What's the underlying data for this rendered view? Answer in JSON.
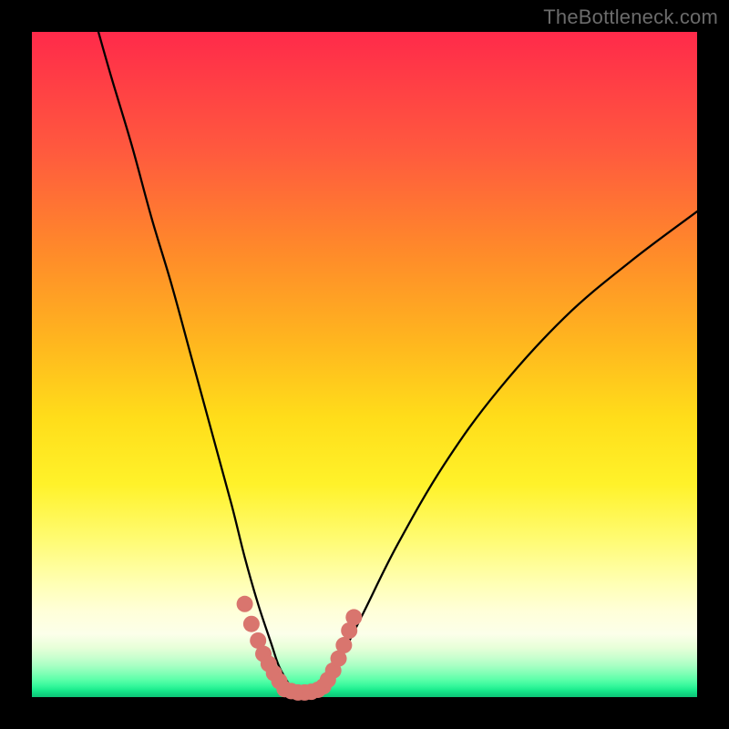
{
  "watermark": "TheBottleneck.com",
  "chart_data": {
    "type": "line",
    "title": "",
    "xlabel": "",
    "ylabel": "",
    "xlim": [
      0,
      100
    ],
    "ylim": [
      0,
      100
    ],
    "grid": false,
    "legend": false,
    "series": [
      {
        "name": "bottleneck-curve",
        "x": [
          10,
          12,
          15,
          18,
          21,
          24,
          27,
          30,
          32,
          34,
          36,
          37,
          38,
          39,
          40,
          41,
          42,
          43,
          44,
          45,
          47,
          50,
          55,
          62,
          70,
          80,
          90,
          100
        ],
        "y": [
          100,
          93,
          83,
          72,
          62,
          51,
          40,
          29,
          21,
          14,
          8,
          5,
          3,
          1.5,
          0.8,
          0.5,
          0.5,
          0.8,
          1.5,
          3,
          7,
          13,
          23,
          35,
          46,
          57,
          65.5,
          73
        ]
      }
    ],
    "optimal_range_x": [
      36,
      45
    ],
    "annotations": [
      {
        "name": "left-marker-cluster",
        "approx_x_range": [
          32,
          38
        ],
        "approx_y_range": [
          3,
          14
        ]
      },
      {
        "name": "right-marker-cluster",
        "approx_x_range": [
          44,
          48
        ],
        "approx_y_range": [
          3,
          12
        ]
      },
      {
        "name": "valley-marker-band",
        "approx_x_range": [
          38,
          44
        ],
        "approx_y_range": [
          0.5,
          2
        ]
      }
    ],
    "gradient_stops": [
      {
        "pct": 0,
        "color": "#ff2a4a"
      },
      {
        "pct": 33,
        "color": "#ff8a2a"
      },
      {
        "pct": 58,
        "color": "#ffdd1a"
      },
      {
        "pct": 85,
        "color": "#ffffc8"
      },
      {
        "pct": 100,
        "color": "#0fc478"
      }
    ],
    "marker_color": "#d9756e"
  }
}
